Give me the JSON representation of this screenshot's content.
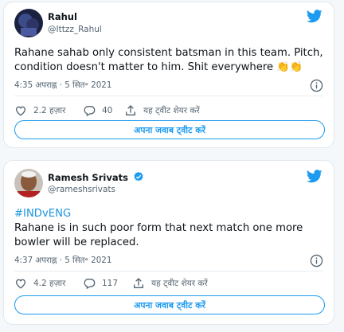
{
  "tweets": [
    {
      "user": {
        "name": "Rahul",
        "handle": "@Ittzz_Rahul",
        "verified": false,
        "avatar_icon": "profile-photo"
      },
      "hashtag": "",
      "text": "Rahane sahab only consistent batsman in this team. Pitch, condition doesn't matter to him. Shit everywhere",
      "emoji": "👏👏",
      "timestamp": "4:35 अपराह्न · 5 सित॰ 2021",
      "likes": "2.2 हज़ार",
      "replies": "40",
      "share_label": "यह ट्वीट शेयर करें",
      "reply_button": "अपना जवाब ट्वीट करें"
    },
    {
      "user": {
        "name": "Ramesh Srivats",
        "handle": "@rameshsrivats",
        "verified": true,
        "avatar_icon": "profile-photo"
      },
      "hashtag": "#INDvENG",
      "text": "Rahane is in such poor form that next match one more bowler will be replaced.",
      "emoji": "",
      "timestamp": "4:37 अपराह्न · 5 सित॰ 2021",
      "likes": "4.2 हज़ार",
      "replies": "117",
      "share_label": "यह ट्वीट शेयर करें",
      "reply_button": "अपना जवाब ट्वीट करें"
    }
  ],
  "colors": {
    "accent": "#1d9bf0",
    "link": "#1b95e0",
    "muted": "#536471",
    "verified": "#1d9bf0"
  },
  "icons": [
    "twitter-bird-icon",
    "info-icon",
    "heart-icon",
    "reply-icon",
    "share-icon",
    "verified-badge-icon"
  ]
}
